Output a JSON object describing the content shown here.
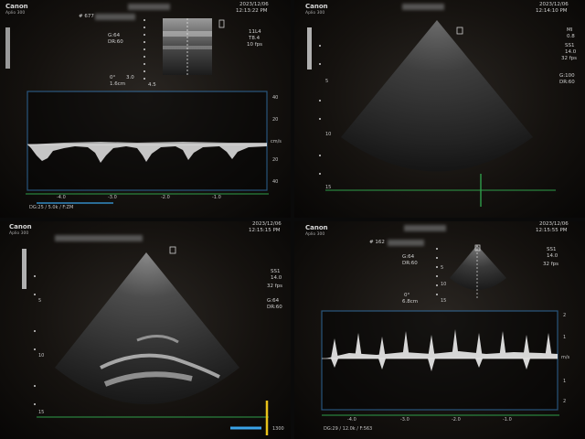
{
  "q1": {
    "brand": "Canon",
    "model": "Aplio 300",
    "date": "2023/12/06",
    "time": "12:13:22 PM",
    "patient_id": "# 677",
    "params": [
      "11L4",
      "T8.4",
      "10 fps"
    ],
    "gain": "G:64",
    "dr": "DR:60",
    "angle": "0°",
    "angle_val": "3.0",
    "depth": "1.6cm",
    "depth_val": "4.5",
    "doppler_scale": [
      "40",
      "20",
      "20",
      "40"
    ],
    "doppler_unit": "cm/s",
    "time_ticks": [
      "-4.0",
      "-3.0",
      "-2.0",
      "-1.0"
    ],
    "status": "DG:25 / 5.0k / F:ZM"
  },
  "q2": {
    "brand": "Canon",
    "model": "Aplio 300",
    "date": "2023/12/06",
    "time": "12:14:10 PM",
    "params": [
      "MI",
      "0.8",
      "SS1",
      "14.0",
      "32 fps"
    ],
    "gain": "G:100",
    "dr": "DR:60",
    "depth_marks": [
      "5",
      "10",
      "15"
    ]
  },
  "q3": {
    "brand": "Canon",
    "model": "Aplio 300",
    "date": "2023/12/06",
    "time": "12:15:15 PM",
    "params": [
      "SS1",
      "14.0",
      "32 fps"
    ],
    "gain": "G:64",
    "dr": "DR:60",
    "depth_marks": [
      "5",
      "10",
      "15"
    ],
    "bpm": "1300"
  },
  "q4": {
    "brand": "Canon",
    "model": "Aplio 300",
    "date": "2023/12/06",
    "time": "12:15:55 PM",
    "patient_id": "# 162",
    "params": [
      "SS1",
      "14.0",
      "32 fps"
    ],
    "gain": "G:64",
    "dr": "DR:60",
    "angle": "0°",
    "depth": "6.8cm",
    "depth_marks": [
      "5",
      "10",
      "15"
    ],
    "doppler_scale": [
      "2",
      "1",
      "1",
      "2"
    ],
    "doppler_unit": "m/s",
    "time_ticks": [
      "-4.0",
      "-3.0",
      "-2.0",
      "-1.0"
    ],
    "status": "DG:29 / 12.0k / F:563"
  },
  "colors": {
    "doppler_border": "#3b8ed8",
    "timeline": "#2f9e4a",
    "marker": "#e8c21a",
    "ecg_bar": "#3aa3e8"
  }
}
